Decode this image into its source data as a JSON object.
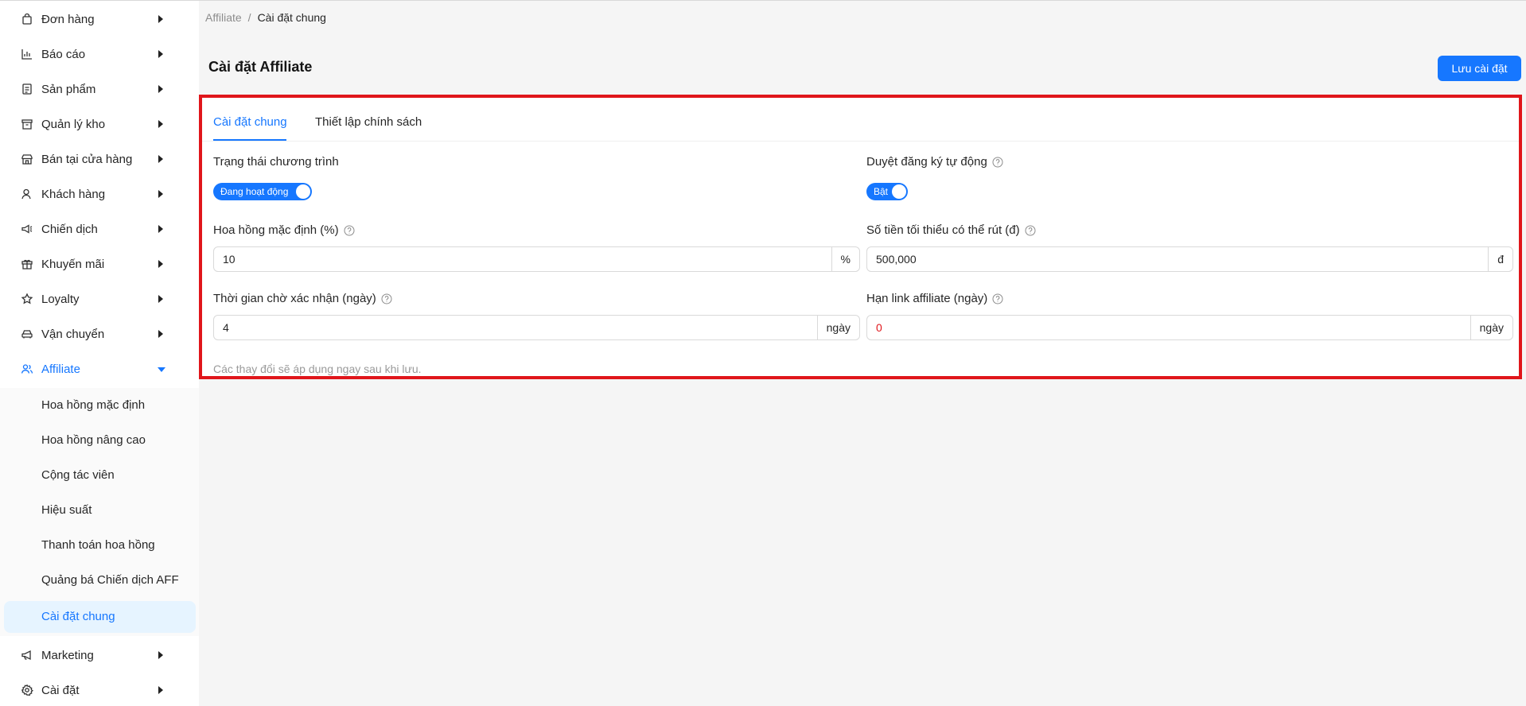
{
  "sidebar": {
    "items": [
      {
        "label": "Đơn hàng",
        "icon": "shopping-bag-icon"
      },
      {
        "label": "Báo cáo",
        "icon": "bar-chart-icon"
      },
      {
        "label": "Sản phẩm",
        "icon": "product-list-icon"
      },
      {
        "label": "Quản lý kho",
        "icon": "warehouse-box-icon"
      },
      {
        "label": "Bán tại cửa hàng",
        "icon": "store-icon"
      },
      {
        "label": "Khách hàng",
        "icon": "user-icon"
      },
      {
        "label": "Chiến dịch",
        "icon": "megaphone-icon"
      },
      {
        "label": "Khuyến mãi",
        "icon": "gift-icon"
      },
      {
        "label": "Loyalty",
        "icon": "star-icon"
      },
      {
        "label": "Vận chuyển",
        "icon": "car-icon"
      },
      {
        "label": "Affiliate",
        "icon": "affiliate-users-icon"
      }
    ],
    "sub_items": [
      {
        "label": "Hoa hồng mặc định"
      },
      {
        "label": "Hoa hồng nâng cao"
      },
      {
        "label": "Cộng tác viên"
      },
      {
        "label": "Hiệu suất"
      },
      {
        "label": "Thanh toán hoa hồng"
      },
      {
        "label": "Quảng bá Chiến dịch AFF"
      },
      {
        "label": "Cài đặt chung"
      }
    ],
    "bottom_items": [
      {
        "label": "Marketing",
        "icon": "marketing-icon"
      },
      {
        "label": "Cài đặt",
        "icon": "gear-icon"
      }
    ]
  },
  "breadcrumb": {
    "parent": "Affiliate",
    "separator": "/",
    "current": "Cài đặt chung"
  },
  "page": {
    "title": "Cài đặt Affiliate",
    "save_label": "Lưu cài đặt"
  },
  "tabs": [
    {
      "label": "Cài đặt chung",
      "active": true
    },
    {
      "label": "Thiết lập chính sách",
      "active": false
    }
  ],
  "form": {
    "program_status": {
      "label": "Trạng thái chương trình",
      "switch_text": "Đang hoạt động",
      "on": true
    },
    "auto_approve": {
      "label": "Duyệt đăng ký tự động",
      "switch_text": "Bật",
      "on": true
    },
    "default_commission": {
      "label": "Hoa hồng mặc định (%)",
      "value": "10",
      "addon": "%"
    },
    "min_withdraw": {
      "label": "Số tiền tối thiểu có thể rút (đ)",
      "value": "500,000",
      "addon": "đ"
    },
    "confirm_wait": {
      "label": "Thời gian chờ xác nhận (ngày)",
      "value": "4",
      "addon": "ngày"
    },
    "link_expiry": {
      "label": "Hạn link affiliate (ngày)",
      "value": "0",
      "addon": "ngày"
    },
    "note": "Các thay đổi sẽ áp dụng ngay sau khi lưu."
  },
  "colors": {
    "accent": "#1677ff",
    "highlight_border": "#e0161b",
    "value_warning": "#e0161b"
  }
}
